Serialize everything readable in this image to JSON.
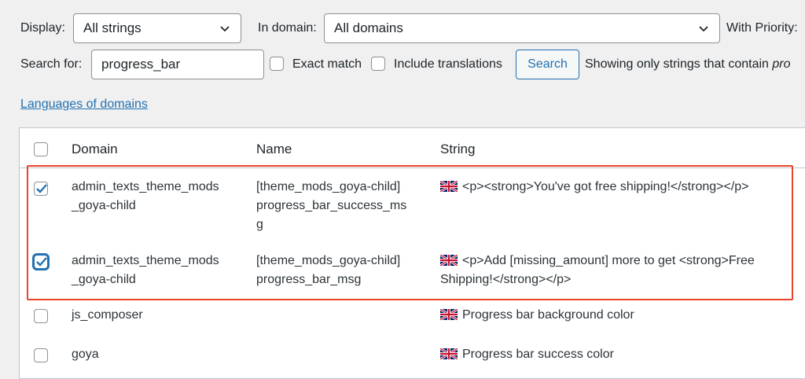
{
  "filters": {
    "display_label": "Display:",
    "display_value": "All strings",
    "domain_label": "In domain:",
    "domain_value": "All domains",
    "priority_label": "With Priority:",
    "search_label": "Search for:",
    "search_value": "progress_bar",
    "exact_match_label": "Exact match",
    "include_translations_label": "Include translations",
    "search_button": "Search",
    "showing_text": "Showing only strings that contain ",
    "showing_term": "pro"
  },
  "languages_link": "Languages of domains",
  "table": {
    "headers": {
      "domain": "Domain",
      "name": "Name",
      "string": "String"
    },
    "rows": [
      {
        "checked": true,
        "domain": [
          "admin_texts_theme_mods",
          "_goya-child"
        ],
        "name": [
          "[theme_mods_goya-child]",
          "progress_bar_success_ms",
          "g"
        ],
        "string": [
          "<p><strong>You've got free shipping!</strong></p>"
        ]
      },
      {
        "checked": true,
        "domain": [
          "admin_texts_theme_mods",
          "_goya-child"
        ],
        "name": [
          "[theme_mods_goya-child]",
          "progress_bar_msg"
        ],
        "string": [
          "<p>Add [missing_amount] more to get <strong>Free",
          "Shipping!</strong></p>"
        ]
      },
      {
        "checked": false,
        "domain": [
          "js_composer"
        ],
        "name": [],
        "string": [
          "Progress bar background color"
        ]
      },
      {
        "checked": false,
        "domain": [
          "goya"
        ],
        "name": [],
        "string": [
          "Progress bar success color"
        ]
      }
    ]
  },
  "colors": {
    "accent": "#2271b1",
    "highlight": "#e8452c"
  }
}
